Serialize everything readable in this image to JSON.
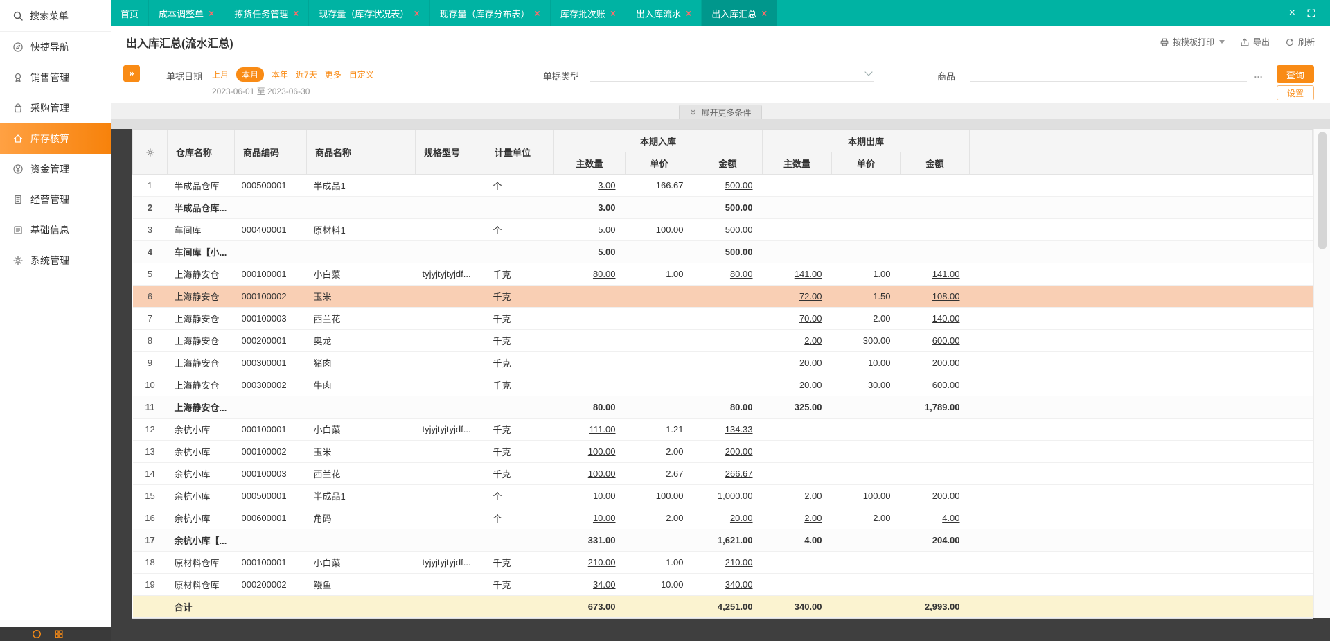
{
  "sidebar": {
    "search_label": "搜索菜单",
    "items": [
      {
        "name": "quick-nav",
        "label": "快捷导航",
        "icon": "compass-icon",
        "active": false
      },
      {
        "name": "sales",
        "label": "销售管理",
        "icon": "medal-icon",
        "active": false
      },
      {
        "name": "purchase",
        "label": "采购管理",
        "icon": "bag-icon",
        "active": false
      },
      {
        "name": "inventory",
        "label": "库存核算",
        "icon": "house-icon",
        "active": true
      },
      {
        "name": "funds",
        "label": "资金管理",
        "icon": "coin-icon",
        "active": false
      },
      {
        "name": "operations",
        "label": "经营管理",
        "icon": "report-icon",
        "active": false
      },
      {
        "name": "basic-info",
        "label": "基础信息",
        "icon": "list-icon",
        "active": false
      },
      {
        "name": "system",
        "label": "系统管理",
        "icon": "gear-icon",
        "active": false
      }
    ]
  },
  "tabbar": {
    "tabs": [
      {
        "name": "home",
        "label": "首页",
        "closable": false,
        "active": false
      },
      {
        "name": "cost-adjust",
        "label": "成本调整单",
        "closable": true,
        "active": false
      },
      {
        "name": "picking-task",
        "label": "拣货任务管理",
        "closable": true,
        "active": false
      },
      {
        "name": "stock-status",
        "label": "现存量（库存状况表）",
        "closable": true,
        "active": false
      },
      {
        "name": "stock-distribution",
        "label": "现存量（库存分布表）",
        "closable": true,
        "active": false
      },
      {
        "name": "batch-ledger",
        "label": "库存批次账",
        "closable": true,
        "active": false
      },
      {
        "name": "in-out-flow",
        "label": "出入库流水",
        "closable": true,
        "active": false
      },
      {
        "name": "in-out-summary",
        "label": "出入库汇总",
        "closable": true,
        "active": true
      }
    ]
  },
  "header": {
    "title": "出入库汇总(流水汇总)",
    "print_label": "按模板打印",
    "export_label": "导出",
    "refresh_label": "刷新"
  },
  "filters": {
    "date_label": "单据日期",
    "date_options": [
      {
        "name": "last-month",
        "label": "上月",
        "selected": false
      },
      {
        "name": "this-month",
        "label": "本月",
        "selected": true
      },
      {
        "name": "this-year",
        "label": "本年",
        "selected": false
      },
      {
        "name": "last-7-days",
        "label": "近7天",
        "selected": false
      },
      {
        "name": "more",
        "label": "更多",
        "selected": false
      },
      {
        "name": "custom",
        "label": "自定义",
        "selected": false
      }
    ],
    "date_range": "2023-06-01 至 2023-06-30",
    "doc_type_label": "单据类型",
    "product_label": "商品",
    "query_button": "查询",
    "settings_button": "设置",
    "expand_more": "展开更多条件"
  },
  "table": {
    "columns": [
      "仓库名称",
      "商品编码",
      "商品名称",
      "规格型号",
      "计量单位"
    ],
    "group_in": "本期入库",
    "group_out": "本期出库",
    "sub_columns": [
      "主数量",
      "单价",
      "金额"
    ],
    "rows": [
      {
        "idx": "1",
        "type": "data",
        "highlight": false,
        "warehouse": "半成品仓库",
        "code": "000500001",
        "name": "半成品1",
        "spec": "",
        "unit": "个",
        "in_qty": "3.00",
        "in_price": "166.67",
        "in_amount": "500.00",
        "out_qty": "",
        "out_price": "",
        "out_amount": ""
      },
      {
        "idx": "2",
        "type": "subtotal",
        "highlight": false,
        "warehouse": "半成品仓库...",
        "code": "",
        "name": "",
        "spec": "",
        "unit": "",
        "in_qty": "3.00",
        "in_price": "",
        "in_amount": "500.00",
        "out_qty": "",
        "out_price": "",
        "out_amount": ""
      },
      {
        "idx": "3",
        "type": "data",
        "highlight": false,
        "warehouse": "车间库",
        "code": "000400001",
        "name": "原材料1",
        "spec": "",
        "unit": "个",
        "in_qty": "5.00",
        "in_price": "100.00",
        "in_amount": "500.00",
        "out_qty": "",
        "out_price": "",
        "out_amount": ""
      },
      {
        "idx": "4",
        "type": "subtotal",
        "highlight": false,
        "warehouse": "车间库【小...",
        "code": "",
        "name": "",
        "spec": "",
        "unit": "",
        "in_qty": "5.00",
        "in_price": "",
        "in_amount": "500.00",
        "out_qty": "",
        "out_price": "",
        "out_amount": ""
      },
      {
        "idx": "5",
        "type": "data",
        "highlight": false,
        "warehouse": "上海静安仓",
        "code": "000100001",
        "name": "小白菜",
        "spec": "tyjyjtyjtyjdf...",
        "unit": "千克",
        "in_qty": "80.00",
        "in_price": "1.00",
        "in_amount": "80.00",
        "out_qty": "141.00",
        "out_price": "1.00",
        "out_amount": "141.00"
      },
      {
        "idx": "6",
        "type": "data",
        "highlight": true,
        "warehouse": "上海静安仓",
        "code": "000100002",
        "name": "玉米",
        "spec": "",
        "unit": "千克",
        "in_qty": "",
        "in_price": "",
        "in_amount": "",
        "out_qty": "72.00",
        "out_price": "1.50",
        "out_amount": "108.00"
      },
      {
        "idx": "7",
        "type": "data",
        "highlight": false,
        "warehouse": "上海静安仓",
        "code": "000100003",
        "name": "西兰花",
        "spec": "",
        "unit": "千克",
        "in_qty": "",
        "in_price": "",
        "in_amount": "",
        "out_qty": "70.00",
        "out_price": "2.00",
        "out_amount": "140.00"
      },
      {
        "idx": "8",
        "type": "data",
        "highlight": false,
        "warehouse": "上海静安仓",
        "code": "000200001",
        "name": "奥龙",
        "spec": "",
        "unit": "千克",
        "in_qty": "",
        "in_price": "",
        "in_amount": "",
        "out_qty": "2.00",
        "out_price": "300.00",
        "out_amount": "600.00"
      },
      {
        "idx": "9",
        "type": "data",
        "highlight": false,
        "warehouse": "上海静安仓",
        "code": "000300001",
        "name": "猪肉",
        "spec": "",
        "unit": "千克",
        "in_qty": "",
        "in_price": "",
        "in_amount": "",
        "out_qty": "20.00",
        "out_price": "10.00",
        "out_amount": "200.00"
      },
      {
        "idx": "10",
        "type": "data",
        "highlight": false,
        "warehouse": "上海静安仓",
        "code": "000300002",
        "name": "牛肉",
        "spec": "",
        "unit": "千克",
        "in_qty": "",
        "in_price": "",
        "in_amount": "",
        "out_qty": "20.00",
        "out_price": "30.00",
        "out_amount": "600.00"
      },
      {
        "idx": "11",
        "type": "subtotal",
        "highlight": false,
        "warehouse": "上海静安仓...",
        "code": "",
        "name": "",
        "spec": "",
        "unit": "",
        "in_qty": "80.00",
        "in_price": "",
        "in_amount": "80.00",
        "out_qty": "325.00",
        "out_price": "",
        "out_amount": "1,789.00"
      },
      {
        "idx": "12",
        "type": "data",
        "highlight": false,
        "warehouse": "余杭小库",
        "code": "000100001",
        "name": "小白菜",
        "spec": "tyjyjtyjtyjdf...",
        "unit": "千克",
        "in_qty": "111.00",
        "in_price": "1.21",
        "in_amount": "134.33",
        "out_qty": "",
        "out_price": "",
        "out_amount": ""
      },
      {
        "idx": "13",
        "type": "data",
        "highlight": false,
        "warehouse": "余杭小库",
        "code": "000100002",
        "name": "玉米",
        "spec": "",
        "unit": "千克",
        "in_qty": "100.00",
        "in_price": "2.00",
        "in_amount": "200.00",
        "out_qty": "",
        "out_price": "",
        "out_amount": ""
      },
      {
        "idx": "14",
        "type": "data",
        "highlight": false,
        "warehouse": "余杭小库",
        "code": "000100003",
        "name": "西兰花",
        "spec": "",
        "unit": "千克",
        "in_qty": "100.00",
        "in_price": "2.67",
        "in_amount": "266.67",
        "out_qty": "",
        "out_price": "",
        "out_amount": ""
      },
      {
        "idx": "15",
        "type": "data",
        "highlight": false,
        "warehouse": "余杭小库",
        "code": "000500001",
        "name": "半成品1",
        "spec": "",
        "unit": "个",
        "in_qty": "10.00",
        "in_price": "100.00",
        "in_amount": "1,000.00",
        "out_qty": "2.00",
        "out_price": "100.00",
        "out_amount": "200.00"
      },
      {
        "idx": "16",
        "type": "data",
        "highlight": false,
        "warehouse": "余杭小库",
        "code": "000600001",
        "name": "角码",
        "spec": "",
        "unit": "个",
        "in_qty": "10.00",
        "in_price": "2.00",
        "in_amount": "20.00",
        "out_qty": "2.00",
        "out_price": "2.00",
        "out_amount": "4.00"
      },
      {
        "idx": "17",
        "type": "subtotal",
        "highlight": false,
        "warehouse": "余杭小库【...",
        "code": "",
        "name": "",
        "spec": "",
        "unit": "",
        "in_qty": "331.00",
        "in_price": "",
        "in_amount": "1,621.00",
        "out_qty": "4.00",
        "out_price": "",
        "out_amount": "204.00"
      },
      {
        "idx": "18",
        "type": "data",
        "highlight": false,
        "warehouse": "原材料仓库",
        "code": "000100001",
        "name": "小白菜",
        "spec": "tyjyjtyjtyjdf...",
        "unit": "千克",
        "in_qty": "210.00",
        "in_price": "1.00",
        "in_amount": "210.00",
        "out_qty": "",
        "out_price": "",
        "out_amount": ""
      },
      {
        "idx": "19",
        "type": "data",
        "highlight": false,
        "warehouse": "原材料仓库",
        "code": "000200002",
        "name": "鳗鱼",
        "spec": "",
        "unit": "千克",
        "in_qty": "34.00",
        "in_price": "10.00",
        "in_amount": "340.00",
        "out_qty": "",
        "out_price": "",
        "out_amount": ""
      }
    ],
    "total": {
      "label": "合计",
      "in_qty": "673.00",
      "in_amount": "4,251.00",
      "out_qty": "340.00",
      "out_amount": "2,993.00"
    }
  },
  "colors": {
    "accent_orange": "#f98b15",
    "teal": "#00b3a3",
    "active_tab": "#00978c",
    "highlight_row": "#f9cfb4",
    "total_row": "#fbf3d0"
  }
}
